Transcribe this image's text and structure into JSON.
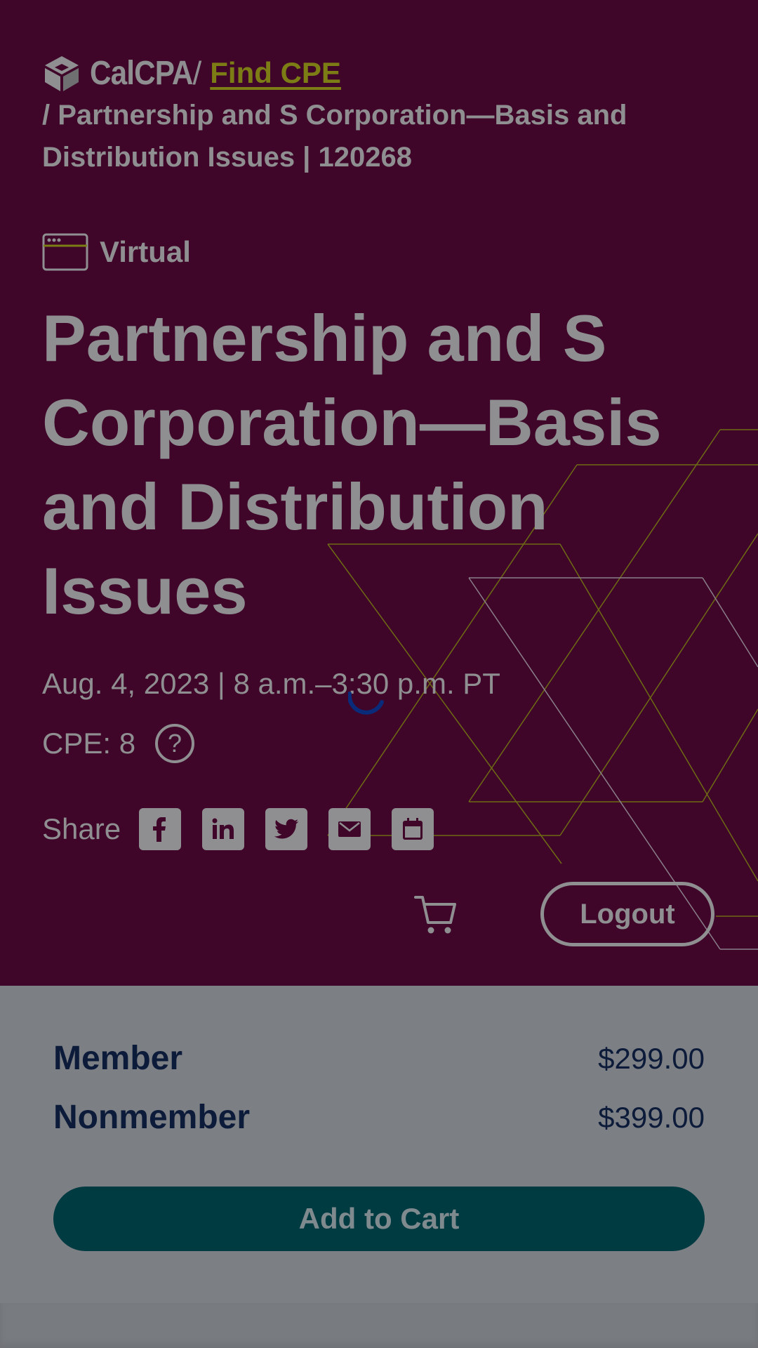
{
  "brand": {
    "name": "CalCPA",
    "separator": "/",
    "find_cpe": "Find CPE"
  },
  "breadcrumb": "/ Partnership and S Corporation—Basis and Distribution Issues | 120268",
  "course": {
    "format": "Virtual",
    "title": "Partnership and S Corporation—Basis and Distribution Issues",
    "dateline": "Aug. 4, 2023 | 8 a.m.–3:30 p.m. PT",
    "cpe": "CPE: 8",
    "help_glyph": "?"
  },
  "share": {
    "label": "Share",
    "icons": [
      "facebook-icon",
      "linkedin-icon",
      "twitter-icon",
      "email-icon",
      "calendar-icon"
    ]
  },
  "account": {
    "logout_label": "Logout",
    "cart_icon": "cart-icon"
  },
  "pricing": [
    {
      "name": "Member",
      "price": "$299.00"
    },
    {
      "name": "Nonmember",
      "price": "$399.00"
    }
  ],
  "add_to_cart_label": "Add to Cart",
  "colors": {
    "hero_bg": "#3f0629",
    "overlay_text": "#8f8f91",
    "link": "#7d7d16",
    "price_text": "#0d1b3a",
    "button_bg": "#003b42",
    "spinner": "#0a2a7a"
  }
}
